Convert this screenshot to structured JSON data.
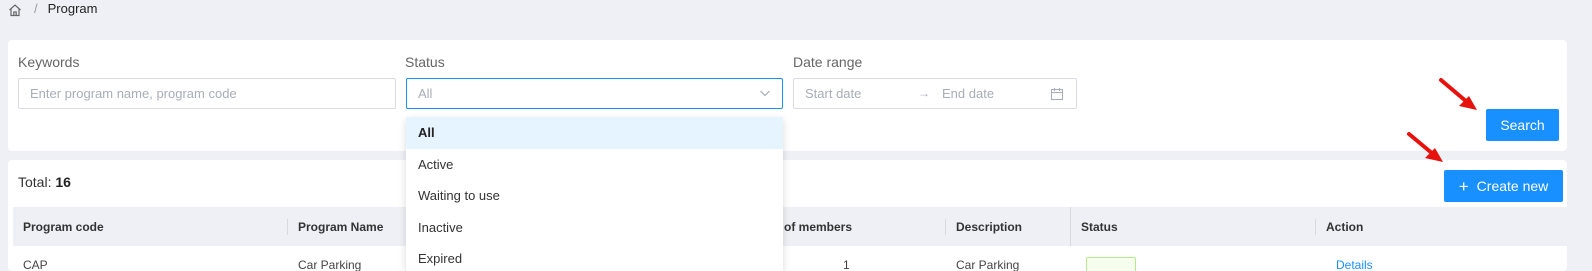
{
  "breadcrumb": {
    "separator": "/",
    "current": "Program"
  },
  "filters": {
    "keywords": {
      "label": "Keywords",
      "placeholder": "Enter program name, program code"
    },
    "status": {
      "label": "Status",
      "value": "All"
    },
    "date_range": {
      "label": "Date range",
      "start_placeholder": "Start date",
      "separator": "→",
      "end_placeholder": "End date"
    },
    "search_label": "Search"
  },
  "list": {
    "total_label": "Total:",
    "total_value": "16",
    "create_label": "Create new",
    "columns": {
      "program_code": "Program code",
      "program_name": "Program Name",
      "members": "of members",
      "description": "Description",
      "status": "Status",
      "action": "Action"
    },
    "row_partial": {
      "code": "CAP",
      "name": "Car Parking",
      "members": "1",
      "description": "Car Parking",
      "action": "Details"
    }
  },
  "status_dropdown": {
    "options": [
      "All",
      "Active",
      "Waiting to use",
      "Inactive",
      "Expired"
    ],
    "selected": "All"
  },
  "colors": {
    "primary": "#1890ff",
    "page_bg": "#eef0f6",
    "annotation": "#e8120c"
  }
}
